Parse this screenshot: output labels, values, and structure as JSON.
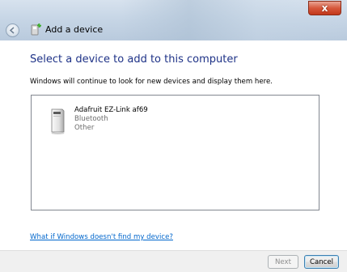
{
  "window": {
    "title": "Add a device",
    "close_label": "x"
  },
  "main": {
    "instruction": "Select a device to add to this computer",
    "subtext": "Windows will continue to look for new devices and display them here.",
    "devices": [
      {
        "name": "Adafruit EZ-Link af69",
        "type": "Bluetooth",
        "category": "Other",
        "icon": "device-generic-icon"
      }
    ],
    "help_link": "What if Windows doesn't find my device?"
  },
  "footer": {
    "next_label": "Next",
    "cancel_label": "Cancel"
  }
}
